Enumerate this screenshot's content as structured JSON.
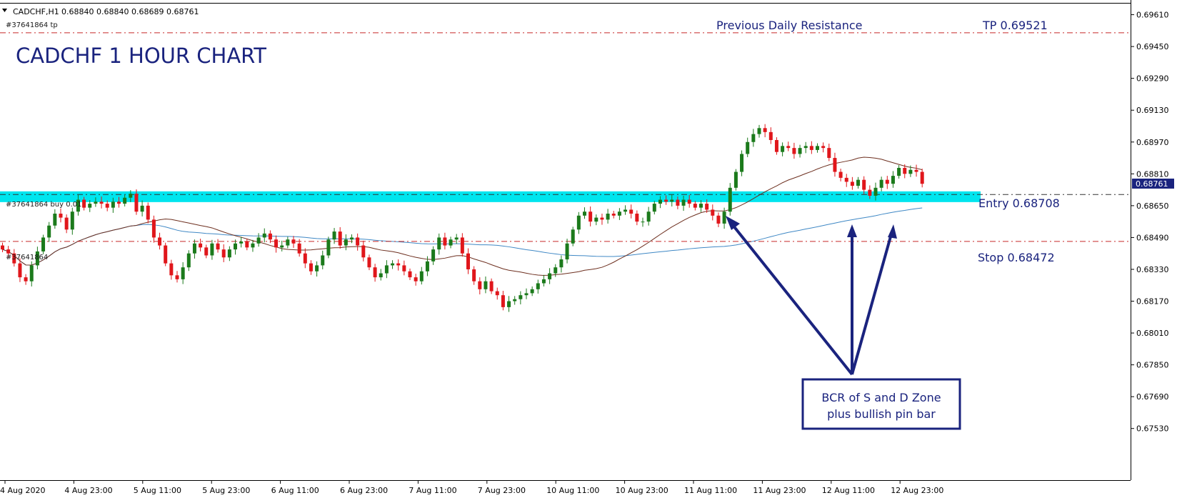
{
  "header": {
    "symbol": "CADCHF,H1",
    "ohlc": "0.68840 0.68840 0.68689 0.68761",
    "tp_tag": "#37641864 tp",
    "buy_tag": "#37641864 buy 0.01",
    "sl_tag": "#37641864"
  },
  "title": "CADCHF 1 HOUR CHART",
  "annotations": {
    "resistance": "Previous Daily Resistance",
    "tp": "TP 0.69521",
    "entry": "Entry 0.68708",
    "stop": "Stop 0.68472",
    "note_line1": "BCR of S and D Zone",
    "note_line2": "plus bullish pin bar"
  },
  "colors": {
    "bull": "#1b7a1b",
    "bear": "#e0161b",
    "zone": "#00e5ee",
    "level_line": "#c62828",
    "ma_fast": "#6d2f1f",
    "ma_slow": "#3f88c5",
    "annotation": "#1a237e",
    "price_tag_bg": "#1a237e"
  },
  "chart_data": {
    "type": "candlestick",
    "title": "CADCHF 1 HOUR CHART",
    "ylim": [
      0.6745,
      0.6963
    ],
    "y_ticks": [
      "0.69610",
      "0.69450",
      "0.69290",
      "0.69130",
      "0.68970",
      "0.68810",
      "0.68650",
      "0.68490",
      "0.68330",
      "0.68170",
      "0.68010",
      "0.67850",
      "0.67690",
      "0.67530"
    ],
    "x_ticks": [
      "4 Aug 2020",
      "4 Aug 23:00",
      "5 Aug 11:00",
      "5 Aug 23:00",
      "6 Aug 11:00",
      "6 Aug 23:00",
      "7 Aug 11:00",
      "7 Aug 23:00",
      "10 Aug 11:00",
      "10 Aug 23:00",
      "11 Aug 11:00",
      "11 Aug 23:00",
      "12 Aug 11:00",
      "12 Aug 23:00"
    ],
    "last_price": "0.68761",
    "levels": {
      "tp": 0.69521,
      "entry": 0.68708,
      "stop": 0.68472
    },
    "zone": [
      0.68668,
      0.68722
    ],
    "close": [
      0.6843,
      0.6841,
      0.6836,
      0.6829,
      0.6827,
      0.6835,
      0.6842,
      0.6849,
      0.6855,
      0.6861,
      0.6859,
      0.6853,
      0.6862,
      0.6868,
      0.6864,
      0.6866,
      0.6867,
      0.6866,
      0.6864,
      0.6867,
      0.6866,
      0.6869,
      0.6871,
      0.6862,
      0.6865,
      0.6858,
      0.6849,
      0.6845,
      0.6836,
      0.683,
      0.6828,
      0.6834,
      0.6841,
      0.6846,
      0.6844,
      0.684,
      0.6846,
      0.6843,
      0.6839,
      0.6843,
      0.6846,
      0.6847,
      0.6844,
      0.6846,
      0.6849,
      0.6851,
      0.6848,
      0.6844,
      0.6845,
      0.6848,
      0.6846,
      0.6841,
      0.6836,
      0.6832,
      0.6835,
      0.684,
      0.6848,
      0.6852,
      0.6845,
      0.6848,
      0.6849,
      0.6845,
      0.6839,
      0.6834,
      0.6829,
      0.6831,
      0.6835,
      0.6836,
      0.6835,
      0.6832,
      0.6829,
      0.6827,
      0.6832,
      0.6837,
      0.6843,
      0.6849,
      0.6845,
      0.6848,
      0.6849,
      0.6841,
      0.6833,
      0.6827,
      0.6823,
      0.6827,
      0.6822,
      0.682,
      0.6814,
      0.6817,
      0.6818,
      0.682,
      0.6821,
      0.6823,
      0.6826,
      0.6828,
      0.6831,
      0.6834,
      0.6838,
      0.6846,
      0.6853,
      0.686,
      0.6862,
      0.6857,
      0.6859,
      0.6858,
      0.6861,
      0.686,
      0.6862,
      0.6863,
      0.6861,
      0.6857,
      0.6857,
      0.6862,
      0.6866,
      0.6868,
      0.6867,
      0.6868,
      0.6865,
      0.6868,
      0.6866,
      0.6864,
      0.6866,
      0.6863,
      0.686,
      0.6856,
      0.6862,
      0.6874,
      0.6882,
      0.6891,
      0.6897,
      0.6901,
      0.6904,
      0.6902,
      0.6898,
      0.6892,
      0.6895,
      0.6894,
      0.6891,
      0.6894,
      0.6895,
      0.6893,
      0.6895,
      0.6894,
      0.6889,
      0.6882,
      0.6879,
      0.6877,
      0.6875,
      0.6878,
      0.6873,
      0.687,
      0.6874,
      0.6878,
      0.6876,
      0.688,
      0.6884,
      0.6881,
      0.6883,
      0.6882,
      0.6876
    ]
  }
}
